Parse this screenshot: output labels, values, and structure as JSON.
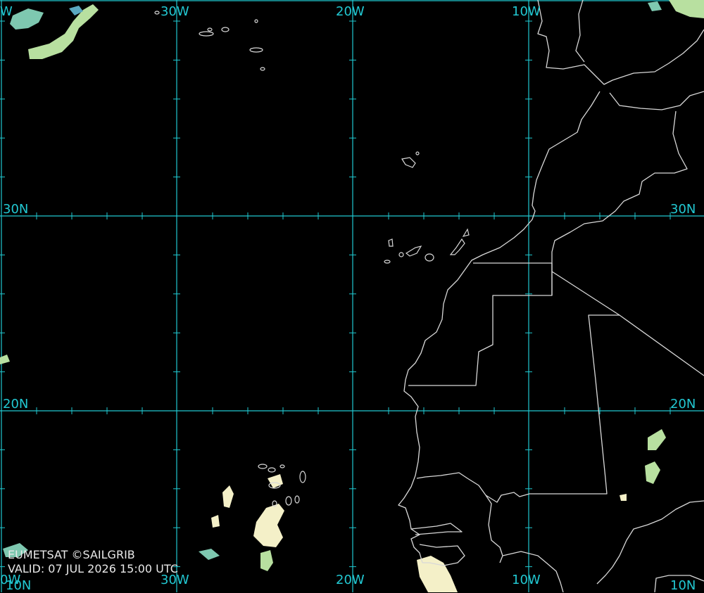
{
  "map": {
    "grid_color": "#20c8d0",
    "coast_color": "#d8d8d8",
    "land_color": "#000000",
    "sea_color": "#000000",
    "cloud_colors": [
      "#f4f0c8",
      "#b8e0a0",
      "#7ec8b0",
      "#5aa8c0"
    ],
    "longitude_labels": {
      "w30": "30W",
      "w20": "20W",
      "w10": "10W",
      "w40_partial": "W",
      "w40_bottom_partial": "0W"
    },
    "latitude_labels": {
      "n30": "30N",
      "n20": "20N",
      "n10": "10N"
    }
  },
  "footer": {
    "credit": "EUMETSAT ©SAILGRIB",
    "valid": "VALID:  07 JUL 2026 15:00 UTC"
  }
}
